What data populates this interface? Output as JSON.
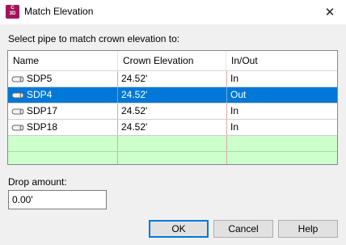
{
  "window": {
    "title": "Match Elevation",
    "icon_text": "C",
    "icon_subtext": "3D",
    "close_glyph": "✕"
  },
  "prompt": "Select pipe to match crown elevation to:",
  "grid": {
    "columns": [
      "Name",
      "Crown Elevation",
      "In/Out"
    ],
    "rows": [
      {
        "name": "SDP5",
        "elevation": "24.52'",
        "inout": "In"
      },
      {
        "name": "SDP4",
        "elevation": "24.52'",
        "inout": "Out"
      },
      {
        "name": "SDP17",
        "elevation": "24.52'",
        "inout": "In"
      },
      {
        "name": "SDP18",
        "elevation": "24.52'",
        "inout": "In"
      }
    ],
    "selected_row_name": "SDP4"
  },
  "drop": {
    "label": "Drop amount:",
    "value": "0.00'"
  },
  "buttons": {
    "ok": "OK",
    "cancel": "Cancel",
    "help": "Help"
  },
  "colors": {
    "selection": "#0078d7",
    "empty_row": "#ccffcc",
    "app_icon": "#a3155b"
  }
}
